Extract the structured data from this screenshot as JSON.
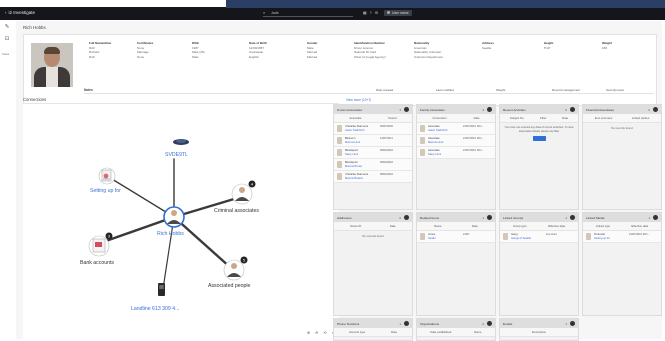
{
  "topbar": {
    "app_title": "i2 Investigate",
    "search_text": "Jade",
    "user_label": "User name"
  },
  "rail": {
    "label": "Tasks"
  },
  "breadcrumb": "Rich Hobbs",
  "profile": {
    "fields": [
      {
        "key": "Full Name/Alias",
        "lines": [
          "Rich",
          "Richard",
          "Rich"
        ]
      },
      {
        "key": "Certificates",
        "lines": [
          "None",
          "Marriage",
          "None"
        ]
      },
      {
        "key": "DOB",
        "lines": [
          "1987",
          "Male (25)",
          "Male"
        ]
      },
      {
        "key": "Date of Birth",
        "lines": [
          "12/09/1987",
          "Caucasian",
          "English"
        ]
      },
      {
        "key": "Gender",
        "lines": [
          "Male",
          "Married",
          "Married"
        ]
      },
      {
        "key": "Identification Number",
        "lines": [
          "Driver Licence",
          "National ID Card",
          "Other Id (Legal Agency)"
        ]
      },
      {
        "key": "Nationality",
        "lines": [
          "American",
          "Nationality Unknown",
          "Unknown Department"
        ]
      },
      {
        "key": "Address",
        "lines": [
          "Seattle"
        ]
      },
      {
        "key": "Height",
        "lines": [
          "5'10\""
        ]
      },
      {
        "key": "Weight",
        "lines": [
          "180"
        ]
      }
    ],
    "notes_label": "Notes",
    "meta": [
      "Date created",
      "Last modified",
      "Weight",
      "Record management",
      "Security level"
    ],
    "view_more": "View more (10+7)"
  },
  "connections": {
    "title": "Connections",
    "center_label": "Rich Hobbs",
    "nodes": {
      "vehicle": "SVDE9TL",
      "setting": "Setting up for",
      "criminal": "Criminal associates",
      "bank": "Bank accounts",
      "associated": "Associated people",
      "phone": "Landline 613 309 4..."
    },
    "badges": {
      "criminal": "4",
      "bank": "3",
      "associated": "5"
    },
    "controls": "⊕ ⊖ ⟲ ▭ ⤢"
  },
  "cards": [
    {
      "title": "Known Associates",
      "count": "4",
      "cols": [
        "Associate",
        "Period"
      ],
      "rows": [
        {
          "name": "Charlotte Stanmore",
          "link": "Jason Stainforth",
          "date": "02/07/2020"
        },
        {
          "name": "Blossom",
          "link": "Marcus Hunt",
          "date": "12/07/2011"
        },
        {
          "name": "Bloodsport",
          "link": "Stacy Hunt",
          "date": "05/04/2010"
        },
        {
          "name": "Bloodsport",
          "link": "Marcus Brown",
          "date": "05/04/2010"
        },
        {
          "name": "Charlotte Stanmore",
          "link": "Marcus Beaton",
          "date": "08/04/2010"
        }
      ]
    },
    {
      "title": "Family Associates",
      "count": "3",
      "cols": [
        "Connection",
        "Date"
      ],
      "rows": [
        {
          "name": "Associate",
          "link": "Jason Stainforth",
          "date": "21/07/2010 18:1..."
        },
        {
          "name": "Associate",
          "link": "Marcus Hunt",
          "date": "21/07/2010 18:1..."
        },
        {
          "name": "Associate",
          "link": "Stacy Hunt",
          "date": "21/07/2010 18:1..."
        }
      ]
    },
    {
      "title": "Recent Activities",
      "count": "0",
      "cols": [
        "Subject No.",
        "Filter",
        "Date"
      ],
      "message": "You have not entered any data of recent activities. To view associated details please tap filter",
      "button": true
    },
    {
      "title": "Financial Associates",
      "count": "0",
      "cols": [
        "Item summary",
        "Linked parties"
      ],
      "empty": "No records found"
    },
    {
      "title": "Addresses",
      "count": "0",
      "cols": [
        "Name ID",
        "Date"
      ],
      "empty": "No records found"
    },
    {
      "title": "Related Items",
      "count": "1",
      "cols": [
        "Name",
        "Date"
      ],
      "rows": [
        {
          "name": "Jones",
          "link": "Sedan",
          "date": "21/07"
        }
      ]
    },
    {
      "title": "Linked Groups",
      "count": "1",
      "cols": [
        "Group type",
        "Effective date"
      ],
      "rows": [
        {
          "name": "Gang",
          "link": "Gangs of Seattle",
          "date": "Ave Hunt"
        }
      ]
    },
    {
      "title": "Linked Media",
      "count": "1",
      "cols": [
        "Linked type",
        "Effective date"
      ],
      "rows": [
        {
          "name": "Financial",
          "link": "Setting up for",
          "date": "21/07/2010 18:1..."
        }
      ]
    },
    {
      "title": "Phone Numbers",
      "count": "1",
      "cols": [
        "Account type",
        "Date"
      ]
    },
    {
      "title": "Organisations",
      "count": "2",
      "cols": [
        "Date established",
        "Name"
      ]
    },
    {
      "title": "Emails",
      "count": "1",
      "cols": [
        "Description"
      ]
    }
  ]
}
